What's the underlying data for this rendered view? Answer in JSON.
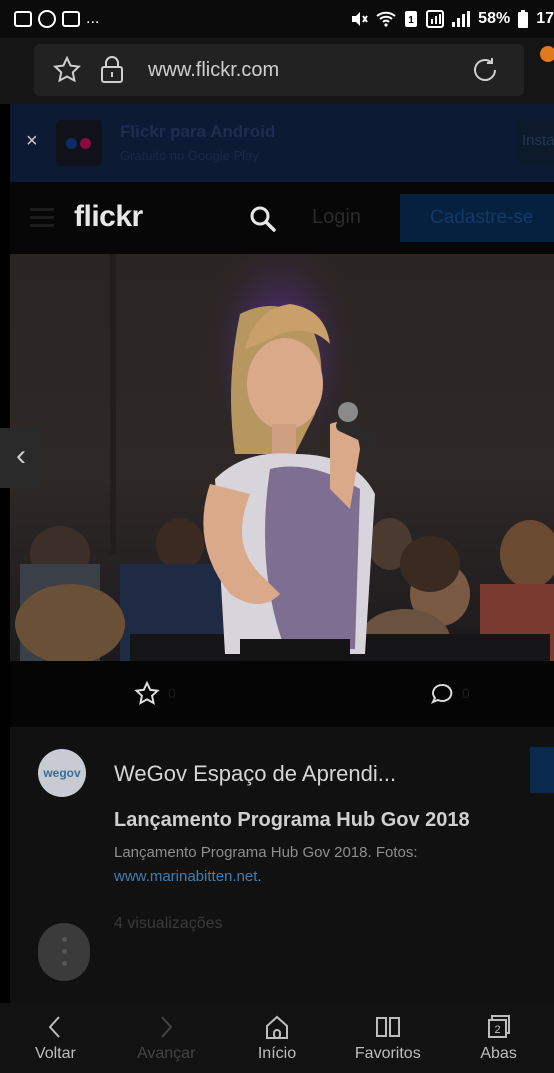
{
  "status_bar": {
    "left_dots": "...",
    "battery": "58%",
    "time_partial": "17",
    "icons": [
      "gallery-icon",
      "pinterest-icon",
      "photo-icon",
      "mute-icon",
      "wifi-icon",
      "sim-icon",
      "signal-icon",
      "battery-icon"
    ]
  },
  "browser": {
    "url": "www.flickr.com",
    "icons": [
      "star-icon",
      "lock-icon",
      "reload-icon",
      "menu-icon"
    ]
  },
  "app_banner": {
    "close": "×",
    "title": "Flickr para Android",
    "subtitle": "Gratuito no Google Play",
    "install_label": "Instalar"
  },
  "flickr_header": {
    "logo": "flickr",
    "login_label": "Login",
    "signup_label": "Cadastre-se"
  },
  "photo": {
    "prev_arrow": "‹"
  },
  "actions": {
    "fav_count": "0",
    "comment_count": "0"
  },
  "info": {
    "avatar_text": "wegov",
    "author": "WeGov Espaço de Aprendi...",
    "title": "Lançamento Programa Hub Gov 2018",
    "description": "Lançamento Programa Hub Gov 2018. Fotos:",
    "link": "www.marinabitten.net",
    "link_suffix": ".",
    "views": "4 visualizações"
  },
  "bottom_nav": {
    "items": [
      {
        "label": "Voltar",
        "icon": "back-icon"
      },
      {
        "label": "Avançar",
        "icon": "forward-icon"
      },
      {
        "label": "Início",
        "icon": "home-icon"
      },
      {
        "label": "Favoritos",
        "icon": "bookmarks-icon"
      },
      {
        "label": "Abas",
        "icon": "tabs-icon",
        "count": "2"
      }
    ]
  },
  "colors": {
    "flickr_blue": "#0063dc",
    "flickr_pink": "#ff0084",
    "link": "#3c7fb6"
  }
}
